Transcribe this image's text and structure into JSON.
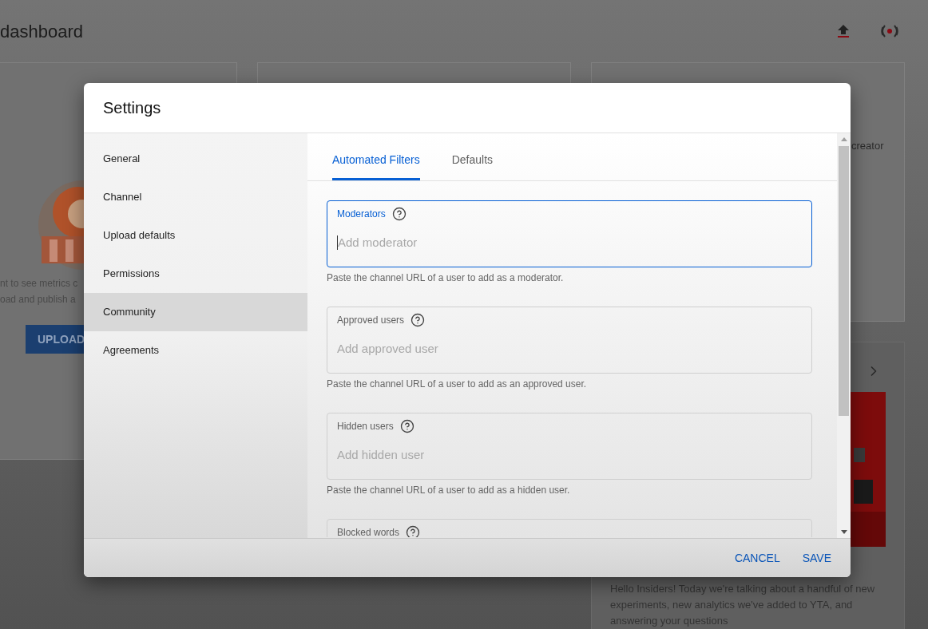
{
  "page": {
    "title": "dashboard"
  },
  "background_cards": {
    "left_lines": [
      "nt to see metrics c",
      "oad and publish a"
    ],
    "upload_button": "UPLOAD",
    "right_top_text": "creator",
    "news_text": "Hello Insiders! Today we're talking about a handful of new experiments, new analytics we've added to YTA, and answering your questions"
  },
  "dialog": {
    "title": "Settings",
    "nav": [
      {
        "label": "General",
        "selected": false
      },
      {
        "label": "Channel",
        "selected": false
      },
      {
        "label": "Upload defaults",
        "selected": false
      },
      {
        "label": "Permissions",
        "selected": false
      },
      {
        "label": "Community",
        "selected": true
      },
      {
        "label": "Agreements",
        "selected": false
      }
    ],
    "tabs": [
      {
        "label": "Automated Filters",
        "selected": true
      },
      {
        "label": "Defaults",
        "selected": false
      }
    ],
    "fields": [
      {
        "label": "Moderators",
        "placeholder": "Add moderator",
        "hint": "Paste the channel URL of a user to add as a moderator.",
        "focused": true
      },
      {
        "label": "Approved users",
        "placeholder": "Add approved user",
        "hint": "Paste the channel URL of a user to add as an approved user.",
        "focused": false
      },
      {
        "label": "Hidden users",
        "placeholder": "Add hidden user",
        "hint": "Paste the channel URL of a user to add as a hidden user.",
        "focused": false
      },
      {
        "label": "Blocked words"
      }
    ],
    "buttons": [
      "CANCEL",
      "SAVE"
    ]
  }
}
